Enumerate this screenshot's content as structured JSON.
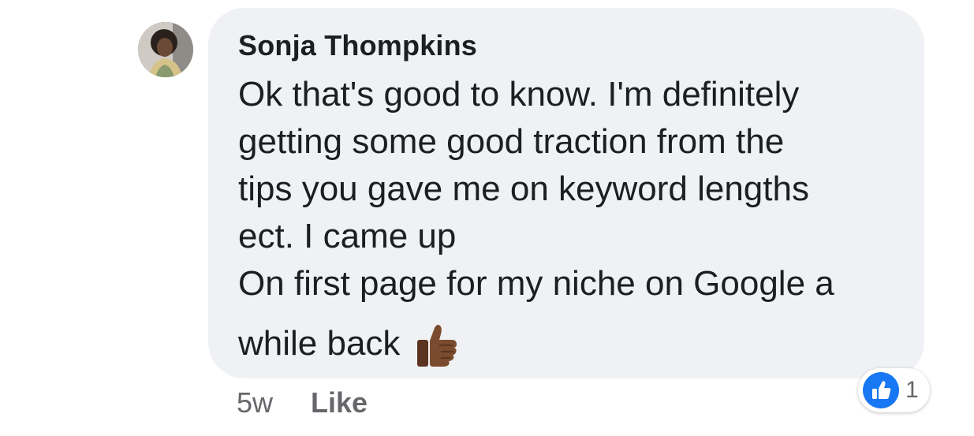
{
  "comment": {
    "author": "Sonja Thompkins",
    "message": "Ok that's good to know. I'm definitely\ngetting some good traction from the\ntips you gave me on keyword lengths\nect. I came up\nOn first page for my niche on Google a",
    "last_line": "while back",
    "emoji": "thumbs-up-medium-dark-skin-tone",
    "timestamp": "5w",
    "like_label": "Like",
    "reaction_count": "1"
  },
  "colors": {
    "bubble": "#f0f1f4",
    "text": "#1c1e21",
    "meta": "#65676b",
    "like_blue": "#1877f2"
  }
}
